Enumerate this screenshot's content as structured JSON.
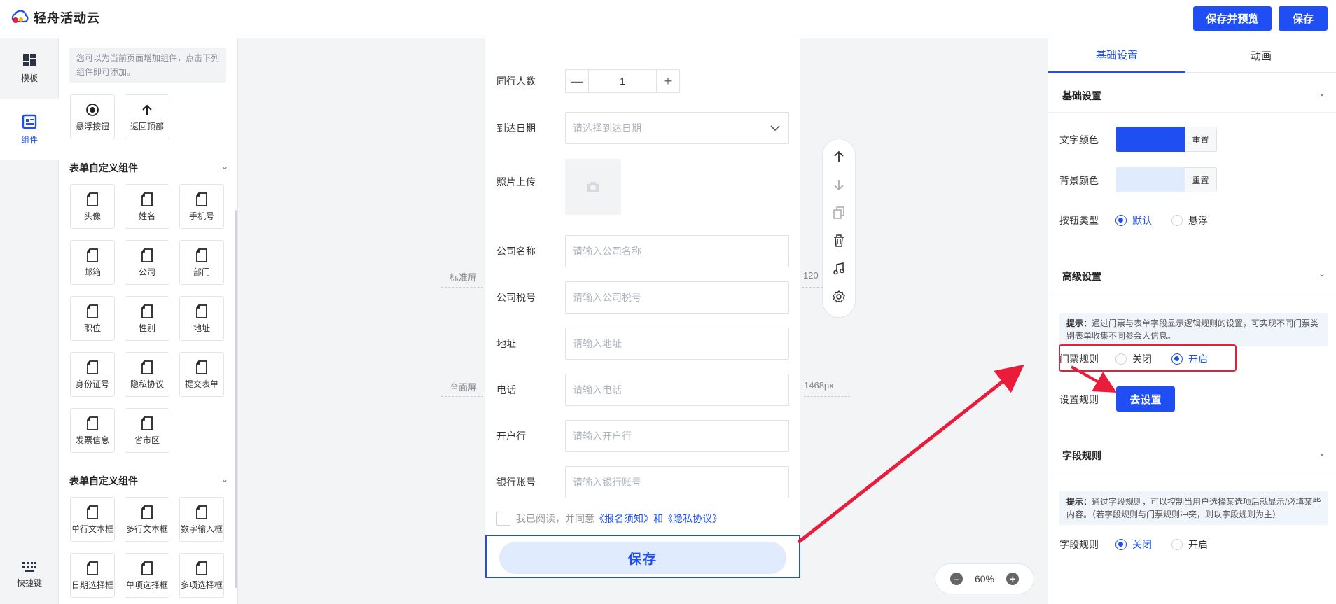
{
  "app": {
    "logo_text": "轻舟活动云"
  },
  "header": {
    "preview_save": "保存并预览",
    "save": "保存"
  },
  "rail": {
    "templates": "模板",
    "components": "组件",
    "shortcuts": "快捷键"
  },
  "library": {
    "hint": "您可以为当前页面增加组件，点击下列组件即可添加。",
    "top_items": [
      "悬浮按钮",
      "返回顶部"
    ],
    "section1_title": "表单自定义组件",
    "section1_items": [
      "头像",
      "姓名",
      "手机号",
      "邮箱",
      "公司",
      "部门",
      "职位",
      "性别",
      "地址",
      "身份证号",
      "隐私协议",
      "提交表单",
      "发票信息",
      "省市区"
    ],
    "section2_title": "表单自定义组件",
    "section2_items": [
      "单行文本框",
      "多行文本框",
      "数字输入框",
      "日期选择框",
      "单项选择框",
      "多项选择框"
    ]
  },
  "canvas": {
    "guide_standard": "标准屏",
    "guide_standard_value": "120",
    "guide_full": "全面屏",
    "guide_full_value": "1468px",
    "zoom": "60%"
  },
  "form": {
    "companions_label": "同行人数",
    "companions_value": "1",
    "arrival_label": "到达日期",
    "arrival_placeholder": "请选择到达日期",
    "photo_label": "照片上传",
    "company_label": "公司名称",
    "company_placeholder": "请输入公司名称",
    "tax_label": "公司税号",
    "tax_placeholder": "请输入公司税号",
    "address_label": "地址",
    "address_placeholder": "请输入地址",
    "phone_label": "电话",
    "phone_placeholder": "请输入电话",
    "bank_label": "开户行",
    "bank_placeholder": "请输入开户行",
    "account_label": "银行账号",
    "account_placeholder": "请输入银行账号",
    "agree_text": "我已阅读，并同意",
    "agree_link": "《报名须知》和《隐私协议》",
    "save_button": "保存"
  },
  "panel": {
    "tab_basic": "基础设置",
    "tab_animation": "动画",
    "basic_section": "基础设置",
    "text_color_label": "文字颜色",
    "bg_color_label": "背景颜色",
    "reset": "重置",
    "button_type_label": "按钮类型",
    "button_type_default": "默认",
    "button_type_float": "悬浮",
    "advanced_section": "高级设置",
    "advanced_tip_bold": "提示：",
    "advanced_tip": "通过门票与表单字段显示逻辑规则的设置，可实现不同门票类别表单收集不同参会人信息。",
    "ticket_rule_label": "门票规则",
    "off": "关闭",
    "on": "开启",
    "set_rule_label": "设置规则",
    "go_set": "去设置",
    "field_section": "字段规则",
    "field_tip_bold": "提示：",
    "field_tip": "通过字段规则，可以控制当用户选择某选项后就显示/必填某些内容。（若字段规则与门票规则冲突，则以字段规则为主）",
    "field_rule_label": "字段规则"
  },
  "colors": {
    "accent": "#1f4ff3",
    "text_color_swatch": "#1f4ff3",
    "bg_color_swatch": "#e0ebfd",
    "annotation_red": "#ea1c3c"
  }
}
